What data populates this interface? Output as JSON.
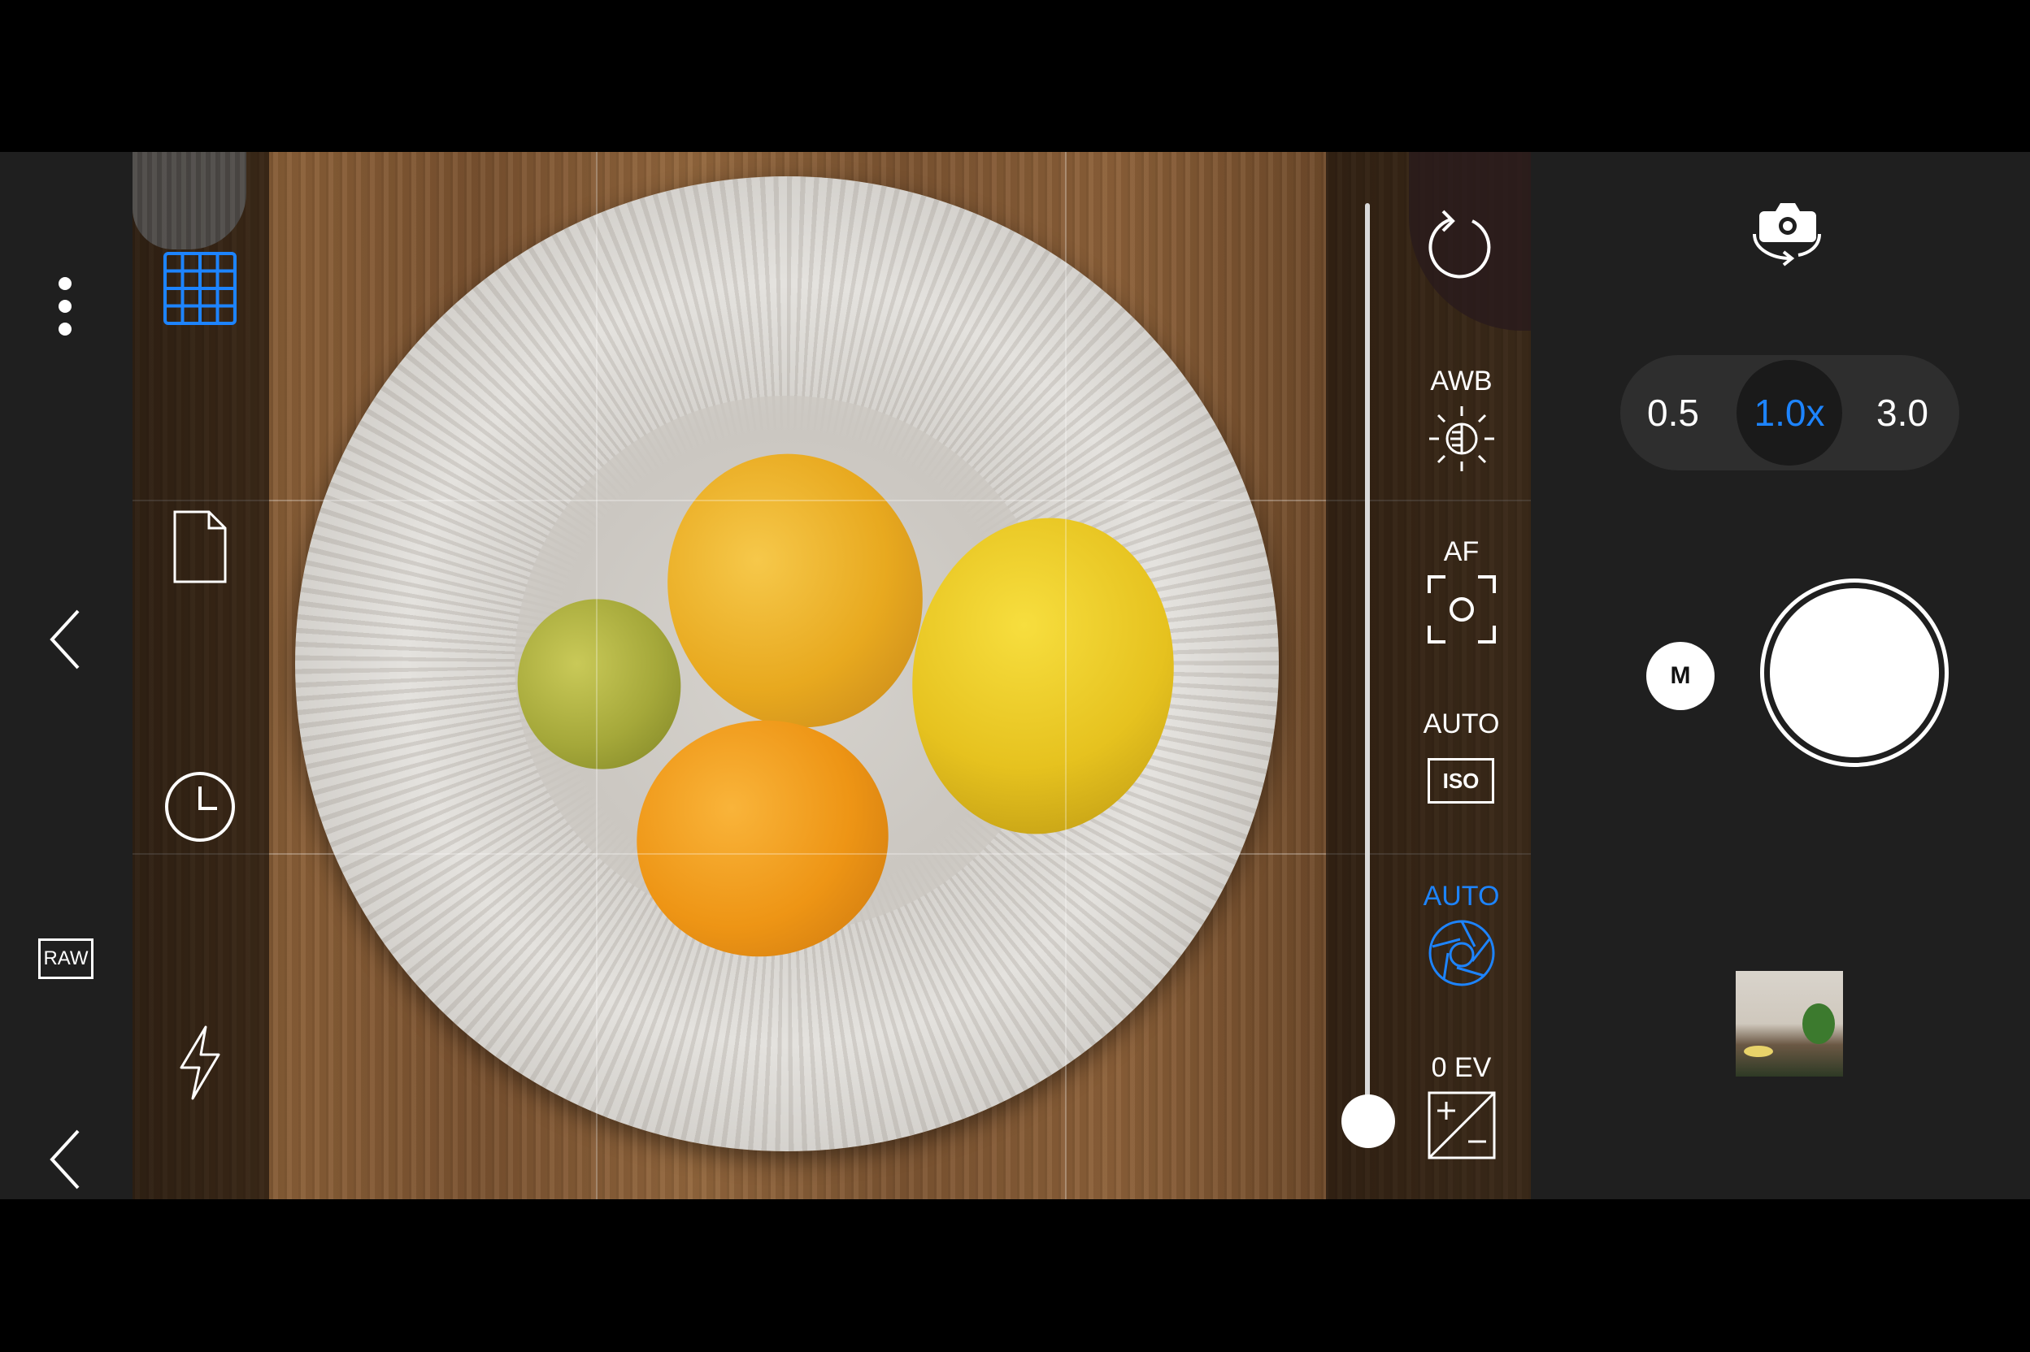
{
  "left_bar": {
    "more_icon": "more-vertical-icon",
    "back_icon_1": "chevron-left-icon",
    "raw_label": "RAW",
    "back_icon_2": "chevron-left-icon"
  },
  "tools": {
    "grid_icon": "grid-icon",
    "file_icon": "file-format-icon",
    "timer_icon": "timer-icon",
    "flash_icon": "flash-icon",
    "grid_active_color": "#1d84ff"
  },
  "right_controls": {
    "reset_icon": "reset-icon",
    "wb_label": "AWB",
    "af_label": "AF",
    "iso_label": "AUTO",
    "iso_badge": "ISO",
    "shutter_label": "AUTO",
    "ev_label": "0 EV",
    "shutter_active_color": "#1d84ff"
  },
  "zoom": {
    "options": [
      "0.5",
      "1.0x",
      "3.0"
    ],
    "selected": "1.0x"
  },
  "capture": {
    "mode_button": "M",
    "switch_camera_icon": "switch-camera-icon"
  },
  "exposure_slider": {
    "value_fraction": 0.97
  }
}
